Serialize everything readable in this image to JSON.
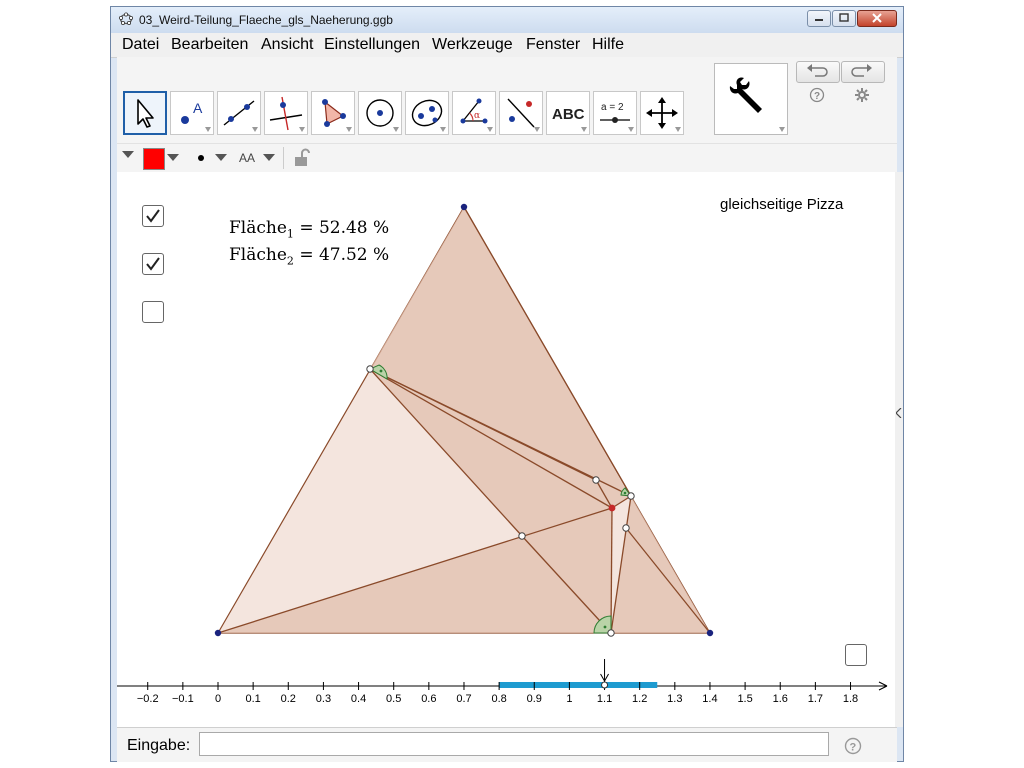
{
  "window": {
    "title": "03_Weird-Teilung_Flaeche_gls_Naeherung.ggb"
  },
  "menu": {
    "items": [
      "Datei",
      "Bearbeiten",
      "Ansicht",
      "Einstellungen",
      "Werkzeuge",
      "Fenster",
      "Hilfe"
    ]
  },
  "toolbar": {
    "tools": [
      {
        "icon": "move-arrow-icon"
      },
      {
        "icon": "point-icon",
        "glyph": "A"
      },
      {
        "icon": "line-icon"
      },
      {
        "icon": "perpendicular-line-icon"
      },
      {
        "icon": "polygon-icon"
      },
      {
        "icon": "circle-icon"
      },
      {
        "icon": "ellipse-icon"
      },
      {
        "icon": "angle-icon",
        "glyph": "α"
      },
      {
        "icon": "reflect-icon"
      },
      {
        "icon": "text-icon",
        "glyph": "ABC"
      },
      {
        "icon": "slider-icon",
        "glyph": "a = 2"
      },
      {
        "icon": "move-view-icon"
      }
    ],
    "settings_icon": "wrench-icon",
    "undo_icon": "undo-icon",
    "redo_icon": "redo-icon",
    "help_icon": "help-icon",
    "gear_icon": "gear-icon"
  },
  "stylebar": {
    "color": "#ff0000",
    "text_size_label": "AA"
  },
  "graphics": {
    "area1_label": "Fläche",
    "area1_sub": "1",
    "area1_value": "= 52.48 %",
    "area2_label": "Fläche",
    "area2_sub": "2",
    "area2_value": "= 47.52 %",
    "title": "gleichseitige Pizza",
    "checkboxes": [
      true,
      true,
      false,
      false
    ],
    "axis_ticks": [
      "−0.2",
      "−0.1",
      "0",
      "0.1",
      "0.2",
      "0.3",
      "0.4",
      "0.5",
      "0.6",
      "0.7",
      "0.8",
      "0.9",
      "1",
      "1.1",
      "1.2",
      "1.3",
      "1.4",
      "1.5",
      "1.6",
      "1.7",
      "1.8"
    ],
    "slider_range": [
      0.8,
      1.25
    ],
    "slider_value": 1.1,
    "fill_color": "#e7c2b2",
    "edge_color": "#8a4a2a",
    "point_color": "#1a237e",
    "slider_color": "#1e9bd0"
  },
  "input_bar": {
    "label": "Eingabe:",
    "value": "",
    "help_icon": "help-icon"
  }
}
